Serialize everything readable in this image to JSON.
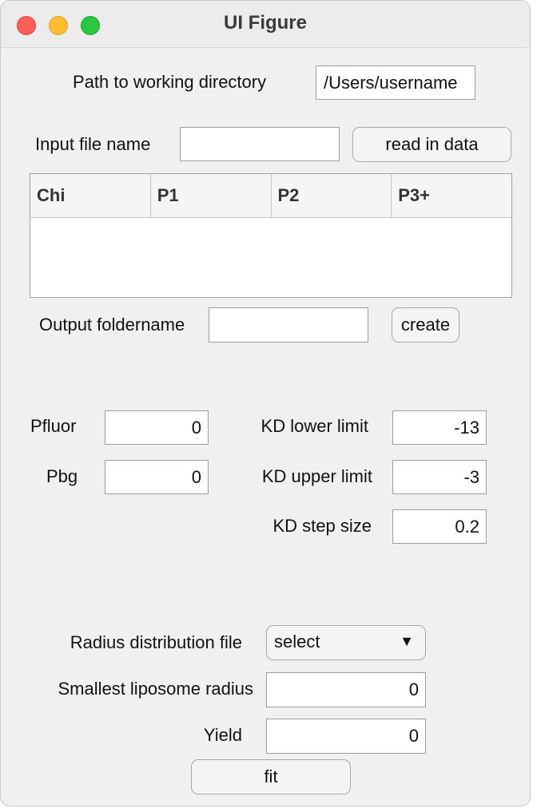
{
  "window": {
    "title": "UI Figure"
  },
  "path": {
    "label": "Path to working directory",
    "value": "/Users/username"
  },
  "input_file": {
    "label": "Input file name",
    "value": "",
    "button": "read in data"
  },
  "table": {
    "columns": [
      "Chi",
      "P1",
      "P2",
      "P3+"
    ]
  },
  "output": {
    "label": "Output foldername",
    "value": "",
    "button": "create"
  },
  "pfluor": {
    "label": "Pfluor",
    "value": "0"
  },
  "pbg": {
    "label": "Pbg",
    "value": "0"
  },
  "kd_lower": {
    "label": "KD lower limit",
    "value": "-13"
  },
  "kd_upper": {
    "label": "KD upper limit",
    "value": "-3"
  },
  "kd_step": {
    "label": "KD step size",
    "value": "0.2"
  },
  "radius_dist": {
    "label": "Radius distribution file",
    "selected": "select"
  },
  "smallest_radius": {
    "label": "Smallest liposome radius",
    "value": "0"
  },
  "yield": {
    "label": "Yield",
    "value": "0"
  },
  "fit": {
    "label": "fit"
  },
  "colors": {
    "close": "#fe5f57",
    "minimize": "#febc2e",
    "zoom": "#28c840"
  }
}
